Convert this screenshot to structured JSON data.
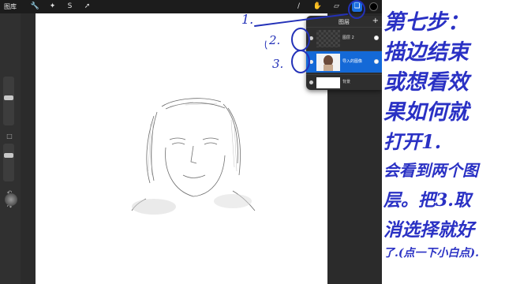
{
  "toolbar": {
    "gallery_label": "图库",
    "icons": [
      "wrench-icon",
      "magic-wand-icon",
      "selection-icon",
      "transform-arrow-icon",
      "brush-icon",
      "smudge-icon",
      "eraser-icon",
      "layers-icon",
      "color-icon"
    ],
    "accent_color": "#1a6fe0"
  },
  "layers_panel": {
    "title": "图层",
    "add_label": "+",
    "layers": [
      {
        "name": "图层 2",
        "selected": false
      },
      {
        "name": "导入的图像",
        "selected": true
      },
      {
        "name": "背景",
        "selected": false
      }
    ]
  },
  "annotations": {
    "step_1": "1.",
    "step_2": "2.",
    "step_3": "3.",
    "pen_color": "#2331b8"
  },
  "notes": {
    "lines": [
      "第七步：",
      "描边结束",
      "或想看效",
      "果如何就",
      "打开1.",
      "会看到两个图",
      "层。把3.取",
      "消选择就好",
      "了.(点一下小白点)."
    ]
  }
}
